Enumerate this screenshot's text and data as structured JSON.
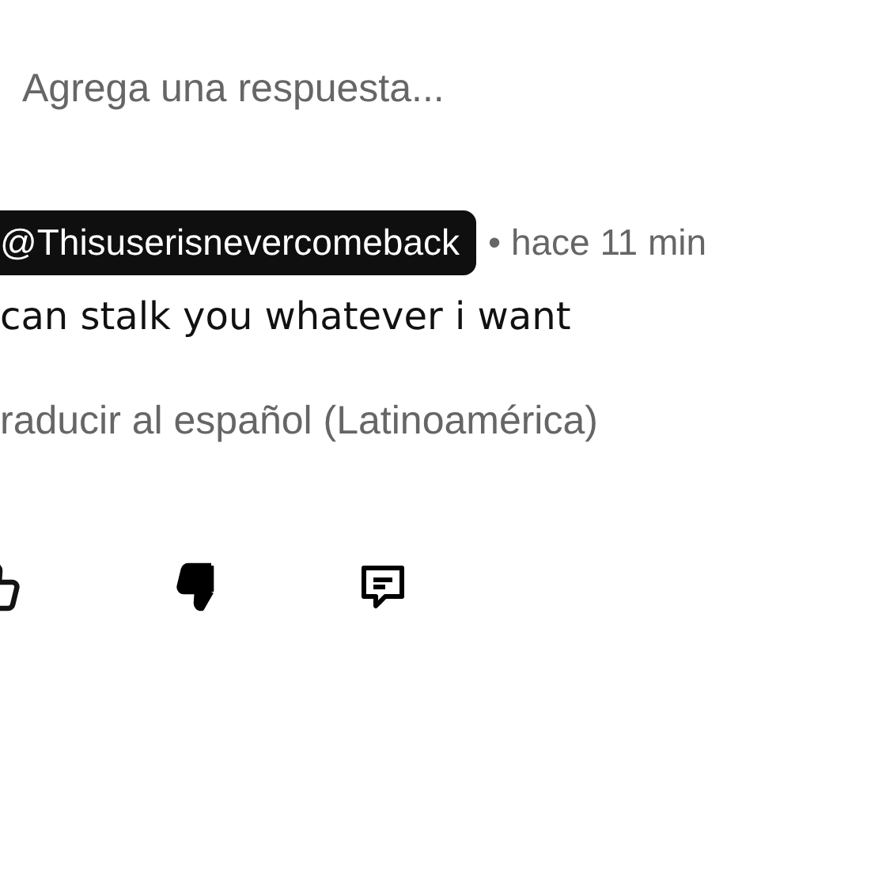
{
  "reply_field": {
    "placeholder": "Agrega una respuesta..."
  },
  "comment": {
    "author": "@Thisuserisnevercomeback",
    "time": "• hace 11 min",
    "text": "can stalk you whatever i want",
    "translate_link": "raducir al español (Latinoamérica)",
    "actions": [
      {
        "kind": "like",
        "selected": false
      },
      {
        "kind": "dislike",
        "selected": true
      },
      {
        "kind": "reply"
      }
    ]
  }
}
